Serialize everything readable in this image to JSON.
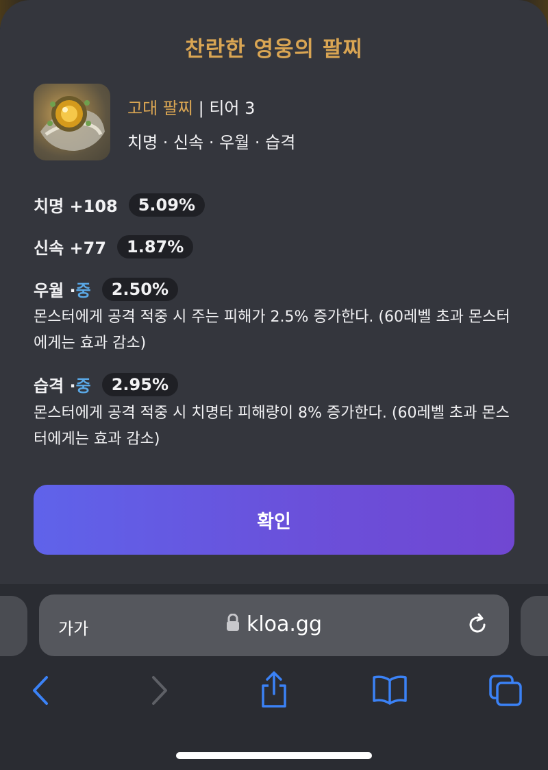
{
  "modal": {
    "title": "찬란한 영웅의 팔찌",
    "item": {
      "grade": "고대 팔찌",
      "separator": "|",
      "tier": "티어 3",
      "stats_line": "치명 · 신속 · 우월 · 습격"
    },
    "stats": [
      {
        "label": "치명 +108",
        "percent": "5.09%"
      },
      {
        "label": "신속 +77",
        "percent": "1.87%"
      }
    ],
    "effects": [
      {
        "name": "우월 · ",
        "grade": "중",
        "percent": "2.50%",
        "description": "몬스터에게 공격 적중 시 주는 피해가 2.5% 증가한다. (60레벨 초과 몬스터에게는 효과 감소)"
      },
      {
        "name": "습격 · ",
        "grade": "중",
        "percent": "2.95%",
        "description": "몬스터에게 공격 적중 시 치명타 피해량이 8% 증가한다. (60레벨 초과 몬스터에게는 효과 감소)"
      }
    ],
    "confirm_label": "확인"
  },
  "browser": {
    "text_size_label": "가가",
    "url": "kloa.gg",
    "icons": {
      "lock": "lock-icon",
      "reload": "reload-icon",
      "back": "chevron-left-icon",
      "forward": "chevron-right-icon",
      "share": "share-icon",
      "bookmarks": "book-icon",
      "tabs": "tabs-icon"
    }
  },
  "colors": {
    "gold": "#d9a553",
    "blue_grade": "#5aa8e6",
    "accent_blue": "#3b82f6",
    "button_gradient_start": "#5f63ea",
    "button_gradient_end": "#7047d2"
  }
}
